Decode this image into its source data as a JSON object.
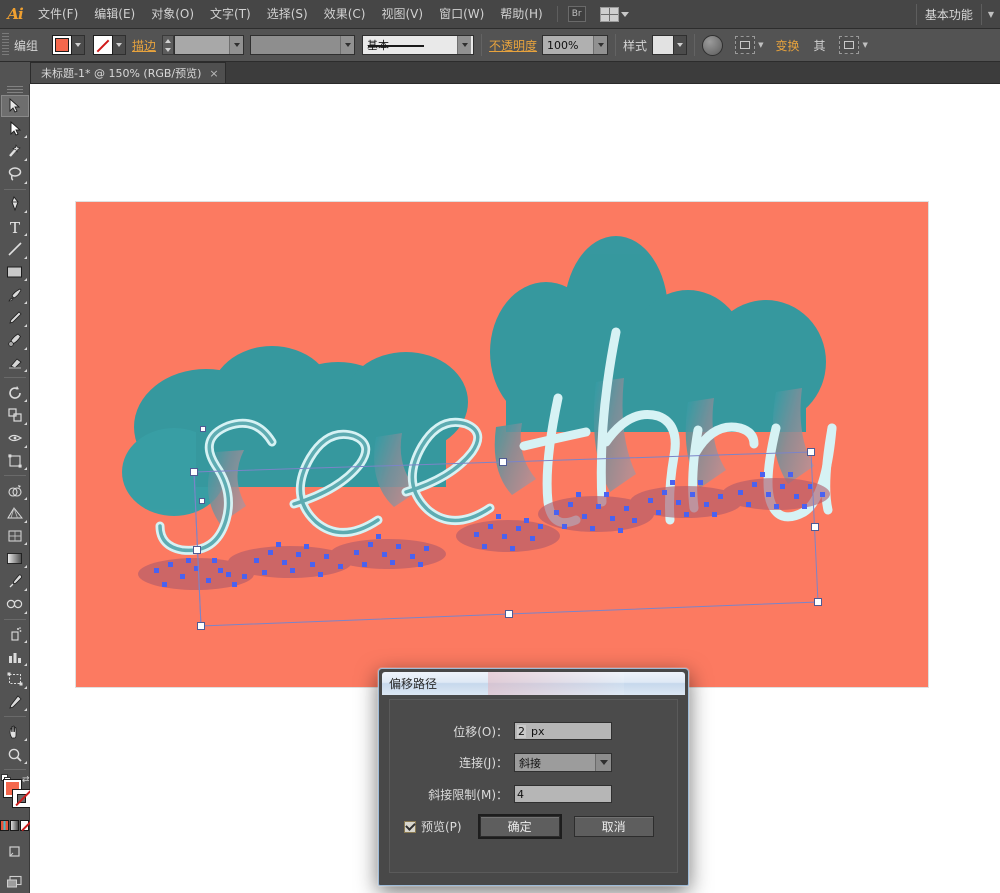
{
  "app": {
    "logo": "Ai",
    "workspace": "基本功能"
  },
  "menubar": {
    "items": [
      {
        "label": "文件(F)"
      },
      {
        "label": "编辑(E)"
      },
      {
        "label": "对象(O)"
      },
      {
        "label": "文字(T)"
      },
      {
        "label": "选择(S)"
      },
      {
        "label": "效果(C)"
      },
      {
        "label": "视图(V)"
      },
      {
        "label": "窗口(W)"
      },
      {
        "label": "帮助(H)"
      }
    ],
    "bridge_icon": "bridge-icon",
    "arrange_icon": "arrange-documents-icon"
  },
  "controlbar": {
    "selection_label": "编组",
    "fill_color": "#f4674c",
    "stroke_color": "none",
    "stroke_label": "描边",
    "stroke_weight": "",
    "profile": "",
    "brush_label": "基本",
    "opacity_label": "不透明度",
    "opacity_value": "100%",
    "style_label": "样式",
    "transform_label": "变换",
    "align_label": "其",
    "shape_label": "",
    "icons": [
      "fill-swatch",
      "stroke-swatch",
      "stroke-weight-stepper",
      "brush-definition",
      "opacity-field",
      "graphic-style-swatch",
      "recolor-artwork-icon",
      "dashed-outline-icon",
      "transform-link",
      "align-icon",
      "shape-options-icon"
    ]
  },
  "tabbar": {
    "tab_title": "未标题-1* @ 150% (RGB/预览)",
    "close_glyph": "×"
  },
  "toolbar": {
    "tools": [
      {
        "name": "selection-tool",
        "active": true
      },
      {
        "name": "direct-selection-tool",
        "active": false
      },
      {
        "name": "magic-wand-tool",
        "active": false
      },
      {
        "name": "lasso-tool",
        "active": false
      },
      {
        "name": "pen-tool",
        "active": false
      },
      {
        "name": "type-tool",
        "active": false
      },
      {
        "name": "line-segment-tool",
        "active": false
      },
      {
        "name": "rectangle-tool",
        "active": false
      },
      {
        "name": "paintbrush-tool",
        "active": false
      },
      {
        "name": "pencil-tool",
        "active": false
      },
      {
        "name": "blob-brush-tool",
        "active": false
      },
      {
        "name": "eraser-tool",
        "active": false
      },
      {
        "name": "rotate-tool",
        "active": false
      },
      {
        "name": "scale-tool",
        "active": false
      },
      {
        "name": "width-tool",
        "active": false
      },
      {
        "name": "free-transform-tool",
        "active": false
      },
      {
        "name": "shape-builder-tool",
        "active": false
      },
      {
        "name": "perspective-grid-tool",
        "active": false
      },
      {
        "name": "mesh-tool",
        "active": false
      },
      {
        "name": "gradient-tool",
        "active": false
      },
      {
        "name": "eyedropper-tool",
        "active": false
      },
      {
        "name": "blend-tool",
        "active": false
      },
      {
        "name": "symbol-sprayer-tool",
        "active": false
      },
      {
        "name": "column-graph-tool",
        "active": false
      },
      {
        "name": "artboard-tool",
        "active": false
      },
      {
        "name": "slice-tool",
        "active": false
      },
      {
        "name": "hand-tool",
        "active": false
      },
      {
        "name": "zoom-tool",
        "active": false
      }
    ],
    "fill_color": "#f4674c",
    "stroke_color": "none",
    "color_modes": [
      "color-swatch-mode",
      "gradient-mode",
      "none-mode"
    ],
    "extra": [
      "draw-mode-icon",
      "screen-mode-icon"
    ]
  },
  "canvas": {
    "artboard_color": "#fc7a61",
    "artwork_text": "see thru",
    "artwork_fill": "#1f9aa0",
    "artwork_outline": "#cfeef0",
    "selection_color": "#4a62f0"
  },
  "dialog": {
    "title": "偏移路径",
    "fields": [
      {
        "label": "位移(O)：",
        "value": "2",
        "unit": "px",
        "type": "text"
      },
      {
        "label": "连接(J)：",
        "value": "斜接",
        "type": "select"
      },
      {
        "label": "斜接限制(M)：",
        "value": "4",
        "type": "text"
      }
    ],
    "preview_label": "预览(P)",
    "preview_checked": true,
    "ok_label": "确定",
    "cancel_label": "取消"
  }
}
